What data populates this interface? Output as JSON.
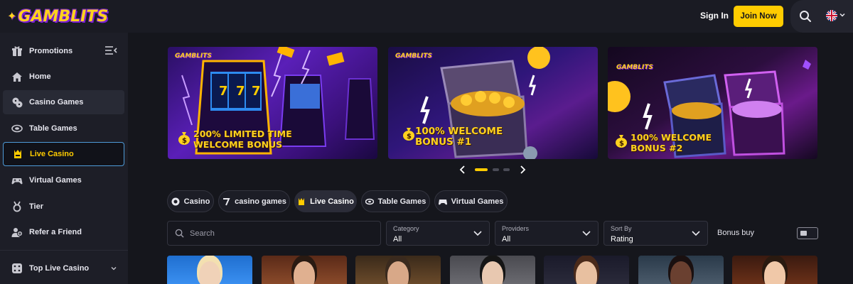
{
  "header": {
    "logo_text": "GAMBLITS",
    "signin_label": "Sign In",
    "join_label": "Join Now",
    "search_icon": "search-icon",
    "language_flag": "uk-flag-icon",
    "accent_color": "#ffcc00"
  },
  "sidebar": {
    "items": [
      {
        "label": "Promotions",
        "icon": "gift-icon"
      },
      {
        "label": "Home",
        "icon": "home-icon"
      },
      {
        "label": "Casino Games",
        "icon": "dice-icon"
      },
      {
        "label": "Table Games",
        "icon": "table-icon"
      },
      {
        "label": "Live Casino",
        "icon": "crown-icon"
      },
      {
        "label": "Virtual Games",
        "icon": "gamepad-icon"
      },
      {
        "label": "Tier",
        "icon": "trophy-icon"
      },
      {
        "label": "Refer a Friend",
        "icon": "users-icon"
      },
      {
        "label": "Top Live Casino",
        "icon": "dice-icon"
      }
    ],
    "active_item": "Live Casino"
  },
  "banners": [
    {
      "line1": "200% LIMITED TIME",
      "line2": "WELCOME BONUS",
      "logo": "GAMBLITS"
    },
    {
      "line1": "100% WELCOME",
      "line2": "BONUS #1",
      "logo": "GAMBLITS"
    },
    {
      "line1": "100% WELCOME",
      "line2": "BONUS #2",
      "logo": "GAMBLITS"
    }
  ],
  "carousel": {
    "current": 1,
    "total": 3
  },
  "chips": [
    {
      "label": "Casino",
      "icon": "casino-chip-icon",
      "active": false
    },
    {
      "label": "casino games",
      "icon": "seven-icon",
      "active": false
    },
    {
      "label": "Live Casino",
      "icon": "crown-icon",
      "active": true
    },
    {
      "label": "Table Games",
      "icon": "table-icon",
      "active": false
    },
    {
      "label": "Virtual Games",
      "icon": "gamepad-icon",
      "active": false
    }
  ],
  "filters": {
    "search_placeholder": "Search",
    "category": {
      "label": "Category",
      "value": "All"
    },
    "providers": {
      "label": "Providers",
      "value": "All"
    },
    "sort": {
      "label": "Sort By",
      "value": "Rating"
    },
    "bonus_buy_label": "Bonus buy",
    "bonus_buy_enabled": false
  }
}
